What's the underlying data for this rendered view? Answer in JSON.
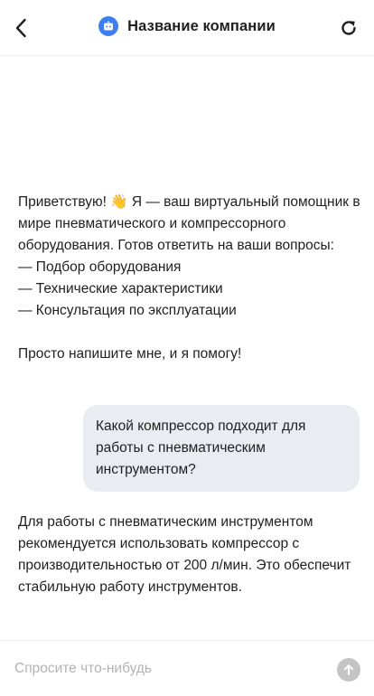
{
  "header": {
    "title": "Название компании",
    "back_icon": "chevron-left-icon",
    "brand_icon": "bot-icon",
    "refresh_icon": "refresh-icon",
    "brand_color": "#3d7ff0"
  },
  "messages": {
    "greeting": {
      "line1": "Приветствую! 👋 Я — ваш виртуальный помощник в мире пневматического и компрессорного оборудования. Готов ответить на ваши вопросы:",
      "items": [
        "— Подбор оборудования",
        "— Технические характеристики",
        "— Консультация по эксплуатации"
      ],
      "closing": "Просто напишите мне, и я помогу!"
    },
    "user_question": "Какой компрессор подходит для работы с пневматическим инструментом?",
    "bot_answer": "Для работы с пневматическим инструментом рекомендуется использовать компрессор с производительностью от 200 л/мин. Это обеспечит стабильную работу инструментов."
  },
  "composer": {
    "placeholder": "Спросите что-нибудь",
    "value": "",
    "send_icon": "arrow-up-icon"
  }
}
